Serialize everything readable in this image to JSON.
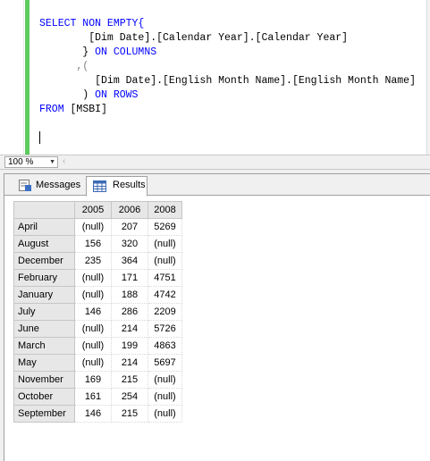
{
  "editor": {
    "lines": [
      [
        {
          "t": "SELECT NON EMPTY{",
          "c": "kw"
        }
      ],
      [
        {
          "t": "        [Dim Date].[Calendar Year].[Calendar Year]",
          "c": ""
        }
      ],
      [
        {
          "t": "       } ",
          "c": ""
        },
        {
          "t": "ON COLUMNS",
          "c": "kw"
        }
      ],
      [
        {
          "t": "      ,(",
          "c": "gr"
        }
      ],
      [
        {
          "t": "         [Dim Date].[English Month Name].[English Month Name]",
          "c": ""
        }
      ],
      [
        {
          "t": "       ) ",
          "c": ""
        },
        {
          "t": "ON ROWS",
          "c": "kw"
        }
      ],
      [
        {
          "t": "FROM ",
          "c": "kw"
        },
        {
          "t": "[MSBI]",
          "c": ""
        }
      ]
    ]
  },
  "zoom": {
    "value": "100 %"
  },
  "tabs": {
    "messages": "Messages",
    "results": "Results"
  },
  "grid": {
    "columns": [
      "2005",
      "2006",
      "2008"
    ],
    "rows": [
      {
        "label": "April",
        "cells": [
          "(null)",
          "207",
          "5269"
        ]
      },
      {
        "label": "August",
        "cells": [
          "156",
          "320",
          "(null)"
        ]
      },
      {
        "label": "December",
        "cells": [
          "235",
          "364",
          "(null)"
        ]
      },
      {
        "label": "February",
        "cells": [
          "(null)",
          "171",
          "4751"
        ]
      },
      {
        "label": "January",
        "cells": [
          "(null)",
          "188",
          "4742"
        ]
      },
      {
        "label": "July",
        "cells": [
          "146",
          "286",
          "2209"
        ]
      },
      {
        "label": "June",
        "cells": [
          "(null)",
          "214",
          "5726"
        ]
      },
      {
        "label": "March",
        "cells": [
          "(null)",
          "199",
          "4863"
        ]
      },
      {
        "label": "May",
        "cells": [
          "(null)",
          "214",
          "5697"
        ]
      },
      {
        "label": "November",
        "cells": [
          "169",
          "215",
          "(null)"
        ]
      },
      {
        "label": "October",
        "cells": [
          "161",
          "254",
          "(null)"
        ]
      },
      {
        "label": "September",
        "cells": [
          "146",
          "215",
          "(null)"
        ]
      }
    ]
  },
  "colors": {
    "keyword": "#0000ff",
    "change_bar": "#5ecb5e",
    "header_bg": "#e7e7e7"
  }
}
